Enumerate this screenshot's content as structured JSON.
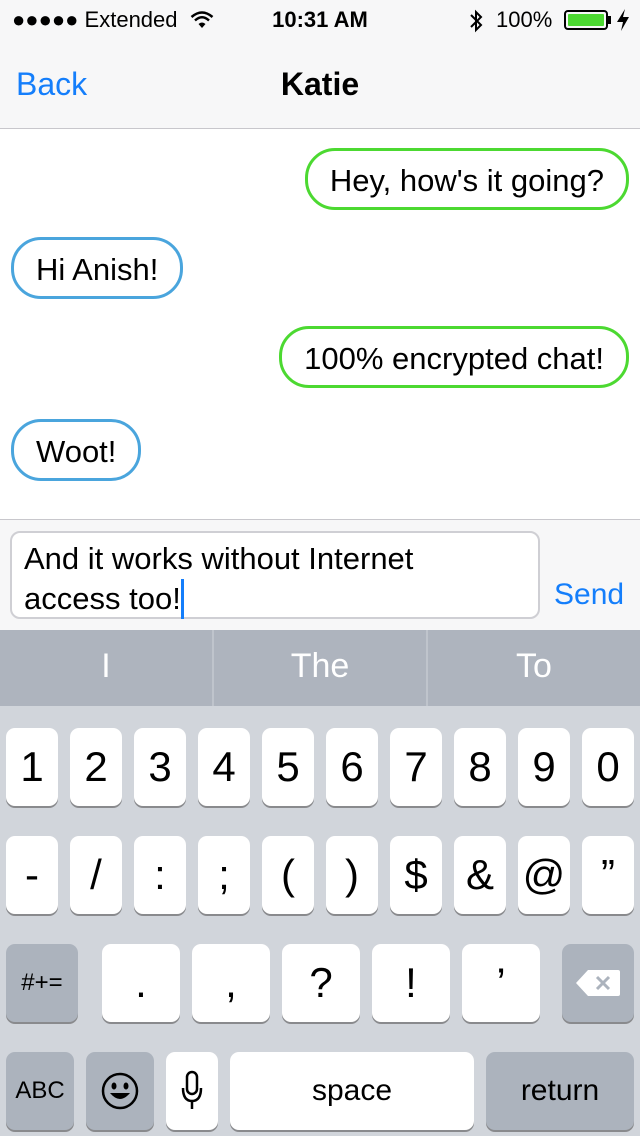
{
  "status": {
    "carrier": "●●●●● Extended",
    "time": "10:31 AM",
    "battery": "100%"
  },
  "nav": {
    "back": "Back",
    "title": "Katie"
  },
  "messages": [
    {
      "dir": "out",
      "text": "Hey, how's it going?"
    },
    {
      "dir": "in",
      "text": "Hi Anish!"
    },
    {
      "dir": "out",
      "text": "100% encrypted chat!"
    },
    {
      "dir": "in",
      "text": "Woot!"
    }
  ],
  "composer": {
    "line1": "And it works without Internet",
    "line2": "access too!",
    "send": "Send"
  },
  "predictive": [
    "I",
    "The",
    "To"
  ],
  "keyboard": {
    "row1": [
      "1",
      "2",
      "3",
      "4",
      "5",
      "6",
      "7",
      "8",
      "9",
      "0"
    ],
    "row2": [
      "-",
      "/",
      ":",
      ";",
      "(",
      ")",
      "$",
      "&",
      "@",
      "”"
    ],
    "row3_mode": "#+=",
    "row3": [
      ".",
      ",",
      "?",
      "!",
      "’"
    ],
    "abc": "ABC",
    "space": "space",
    "return": "return"
  },
  "colors": {
    "accent": "#147efb",
    "outgoing_border": "#4cd931",
    "incoming_border": "#4aa5dd"
  }
}
